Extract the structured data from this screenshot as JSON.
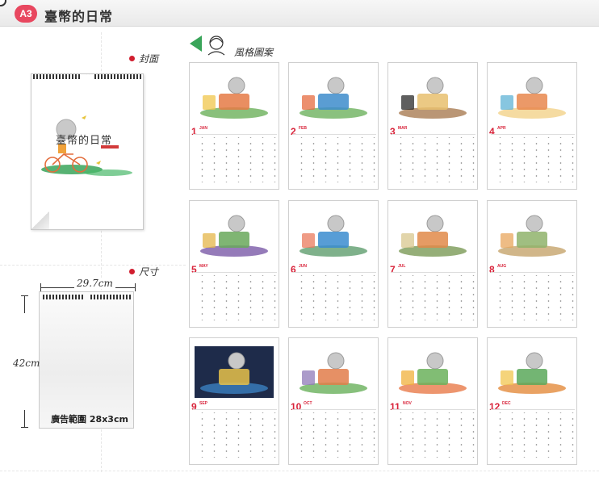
{
  "header": {
    "badge": "A3",
    "title": "臺幣的日常"
  },
  "labels": {
    "cover": "封面",
    "size": "尺寸",
    "style": "風格圖案"
  },
  "cover": {
    "title": "臺幣的日常"
  },
  "dimensions": {
    "width": "29.7cm",
    "height": "42cm",
    "ad_area": "廣告範圍 28x3cm"
  },
  "months": [
    {
      "num": "1",
      "abbr": "JAN"
    },
    {
      "num": "2",
      "abbr": "FEB"
    },
    {
      "num": "3",
      "abbr": "MAR"
    },
    {
      "num": "4",
      "abbr": "APR"
    },
    {
      "num": "5",
      "abbr": "MAY"
    },
    {
      "num": "6",
      "abbr": "JUN"
    },
    {
      "num": "7",
      "abbr": "JUL"
    },
    {
      "num": "8",
      "abbr": "AUG"
    },
    {
      "num": "9",
      "abbr": "SEP"
    },
    {
      "num": "10",
      "abbr": "OCT"
    },
    {
      "num": "11",
      "abbr": "NOV"
    },
    {
      "num": "12",
      "abbr": "DEC"
    }
  ],
  "colors": {
    "accent_red": "#d8233a",
    "badge": "#e8475f",
    "green": "#3aa55a"
  }
}
